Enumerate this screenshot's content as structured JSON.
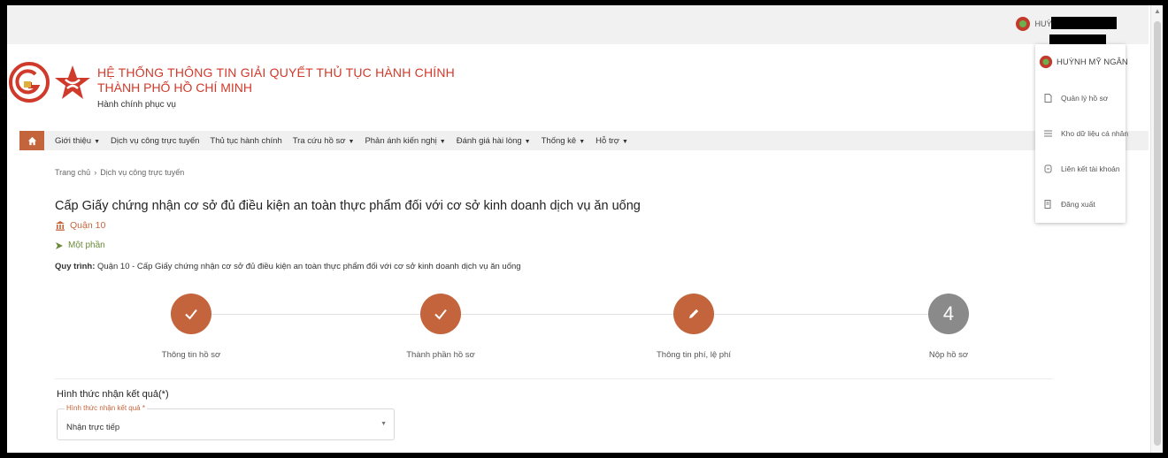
{
  "top_user": {
    "name": "HUỲNH MỸ NGÂN"
  },
  "header": {
    "title_line1": "HỆ THỐNG THÔNG TIN GIẢI QUYẾT THỦ TỤC HÀNH CHÍNH",
    "title_line2": "THÀNH PHỐ HỒ CHÍ MINH",
    "subtitle": "Hành chính phục vụ"
  },
  "nav": {
    "items": [
      {
        "label": "Giới thiệu",
        "has_caret": true
      },
      {
        "label": "Dịch vụ công trực tuyến",
        "has_caret": false
      },
      {
        "label": "Thủ tục hành chính",
        "has_caret": false
      },
      {
        "label": "Tra cứu hồ sơ",
        "has_caret": true
      },
      {
        "label": "Phản ánh kiến nghị",
        "has_caret": true
      },
      {
        "label": "Đánh giá hài lòng",
        "has_caret": true
      },
      {
        "label": "Thống kê",
        "has_caret": true
      },
      {
        "label": "Hỗ trợ",
        "has_caret": true
      }
    ]
  },
  "breadcrumb": {
    "home": "Trang chủ",
    "separator": "›",
    "current": "Dịch vụ công trực tuyến"
  },
  "procedure": {
    "title": "Cấp Giấy chứng nhận cơ sở đủ điều kiện an toàn thực phẩm đối với cơ sở kinh doanh dịch vụ ăn uống",
    "agency": "Quận 10",
    "level": "Một phần",
    "flow_label": "Quy trình:",
    "flow_value": "Quận 10 - Cấp Giấy chứng nhận cơ sở đủ điều kiện an toàn thực phẩm đối với cơ sở kinh doanh dịch vụ ăn uống"
  },
  "steps": [
    {
      "label": "Thông tin hồ sơ",
      "state": "done"
    },
    {
      "label": "Thành phần hồ sơ",
      "state": "done"
    },
    {
      "label": "Thông tin phí, lệ phí",
      "state": "active"
    },
    {
      "label": "Nộp hồ sơ",
      "state": "todo",
      "number": "4"
    }
  ],
  "form": {
    "label": "Hình thức nhận kết quả(*)",
    "float_label": "Hình thức nhận kết quả *",
    "value": "Nhận trực tiếp"
  },
  "dropdown": {
    "user": "HUỲNH MỸ NGÂN",
    "items": [
      {
        "label": "Quản lý hồ sơ",
        "icon": "file-icon"
      },
      {
        "label": "Kho dữ liệu cá nhân",
        "icon": "list-icon"
      },
      {
        "label": "Liên kết tài khoản",
        "icon": "link-icon"
      },
      {
        "label": "Đăng xuất",
        "icon": "logout-icon"
      }
    ]
  },
  "colors": {
    "brand": "#d03a2a",
    "accent": "#c4643d",
    "todo": "#8a8a8a"
  }
}
